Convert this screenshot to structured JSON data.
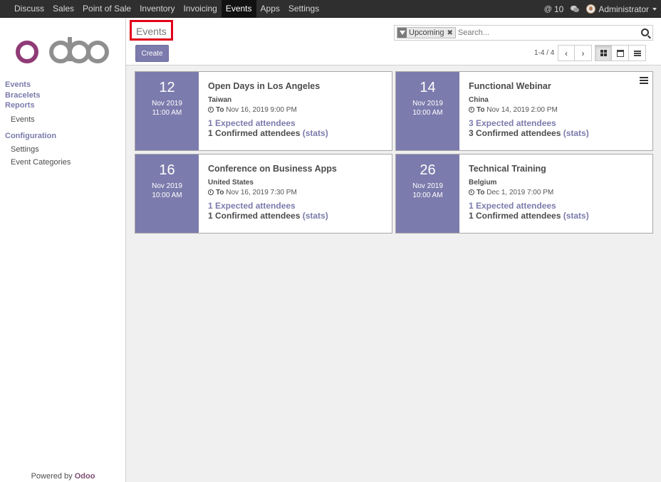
{
  "topbar": {
    "menu": [
      "Discuss",
      "Sales",
      "Point of Sale",
      "Inventory",
      "Invoicing",
      "Events",
      "Apps",
      "Settings"
    ],
    "active": "Events",
    "messages_count": "10",
    "user": "Administrator"
  },
  "sidebar": {
    "sections": [
      {
        "label": "Events",
        "children": []
      },
      {
        "label": "Bracelets",
        "children": []
      },
      {
        "label": "Reports",
        "children": [
          "Events"
        ]
      },
      {
        "label": "Configuration",
        "children": [
          "Settings",
          "Event Categories"
        ]
      }
    ],
    "powered_prefix": "Powered by",
    "powered_brand": "Odoo"
  },
  "control": {
    "breadcrumb": "Events",
    "create_label": "Create",
    "search_facet": "Upcoming",
    "search_placeholder": "Search...",
    "pager": "1-4 / 4"
  },
  "events": [
    {
      "day": "12",
      "month": "Nov 2019",
      "time": "11:00 AM",
      "title": "Open Days in Los Angeles",
      "location": "Taiwan",
      "to_label": "To",
      "end": "Nov 16, 2019 9:00 PM",
      "expected": "1 Expected attendees",
      "confirmed": "1 Confirmed attendees",
      "stats": "(stats)"
    },
    {
      "day": "14",
      "month": "Nov 2019",
      "time": "10:00 AM",
      "title": "Functional Webinar",
      "location": "China",
      "to_label": "To",
      "end": "Nov 14, 2019 2:00 PM",
      "expected": "3 Expected attendees",
      "confirmed": "3 Confirmed attendees",
      "stats": "(stats)"
    },
    {
      "day": "16",
      "month": "Nov 2019",
      "time": "10:00 AM",
      "title": "Conference on Business Apps",
      "location": "United States",
      "to_label": "To",
      "end": "Nov 16, 2019 7:30 PM",
      "expected": "1 Expected attendees",
      "confirmed": "1 Confirmed attendees",
      "stats": "(stats)"
    },
    {
      "day": "26",
      "month": "Nov 2019",
      "time": "10:00 AM",
      "title": "Technical Training",
      "location": "Belgium",
      "to_label": "To",
      "end": "Dec 1, 2019 7:00 PM",
      "expected": "1 Expected attendees",
      "confirmed": "1 Confirmed attendees",
      "stats": "(stats)"
    }
  ],
  "colors": {
    "accent": "#7c7bad",
    "brand": "#875a7b",
    "highlight_border": "#e0001a"
  }
}
